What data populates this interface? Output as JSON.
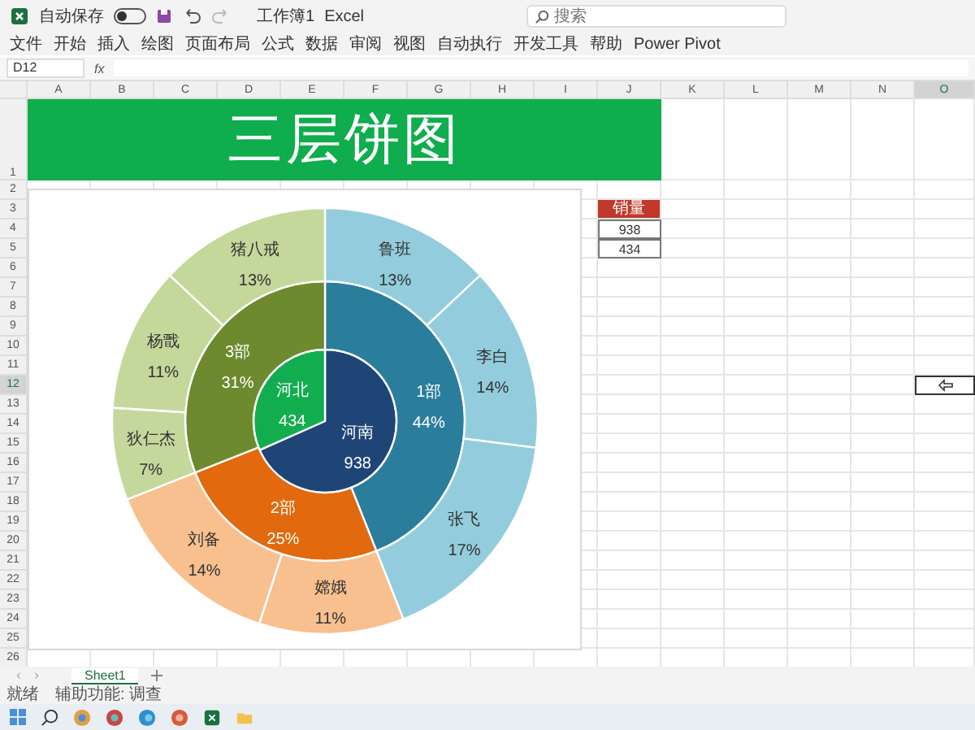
{
  "window": {
    "autosave_label": "自动保存",
    "autosave_on": false,
    "title": "工作簿1",
    "app_name": "Excel",
    "search": {
      "placeholder": "搜索"
    }
  },
  "ribbon_tabs": [
    "文件",
    "开始",
    "插入",
    "绘图",
    "页面布局",
    "公式",
    "数据",
    "审阅",
    "视图",
    "自动执行",
    "开发工具",
    "帮助",
    "Power Pivot"
  ],
  "formula_bar": {
    "name_box": "D12",
    "fx": "fx"
  },
  "sheet": {
    "columns": [
      {
        "label": "A",
        "selected": false
      },
      {
        "label": "B",
        "selected": false
      },
      {
        "label": "C",
        "selected": false
      },
      {
        "label": "D",
        "selected": false
      },
      {
        "label": "E",
        "selected": false
      },
      {
        "label": "F",
        "selected": false
      },
      {
        "label": "G",
        "selected": false
      },
      {
        "label": "H",
        "selected": false
      },
      {
        "label": "I",
        "selected": false
      },
      {
        "label": "J",
        "selected": false
      },
      {
        "label": "K",
        "selected": false
      },
      {
        "label": "L",
        "selected": false
      },
      {
        "label": "M",
        "selected": false
      },
      {
        "label": "N",
        "selected": false
      },
      {
        "label": "O",
        "selected": true
      }
    ],
    "rows": [
      {
        "label": "1",
        "selected": false
      },
      {
        "label": "2",
        "selected": false
      },
      {
        "label": "3",
        "selected": false
      },
      {
        "label": "4",
        "selected": false
      },
      {
        "label": "5",
        "selected": false
      },
      {
        "label": "6",
        "selected": false
      },
      {
        "label": "7",
        "selected": false
      },
      {
        "label": "8",
        "selected": false
      },
      {
        "label": "9",
        "selected": false
      },
      {
        "label": "10",
        "selected": false
      },
      {
        "label": "11",
        "selected": false
      },
      {
        "label": "12",
        "selected": true
      },
      {
        "label": "13",
        "selected": false
      },
      {
        "label": "14",
        "selected": false
      },
      {
        "label": "15",
        "selected": false
      },
      {
        "label": "16",
        "selected": false
      },
      {
        "label": "17",
        "selected": false
      },
      {
        "label": "18",
        "selected": false
      },
      {
        "label": "19",
        "selected": false
      },
      {
        "label": "20",
        "selected": false
      },
      {
        "label": "21",
        "selected": false
      },
      {
        "label": "22",
        "selected": false
      },
      {
        "label": "23",
        "selected": false
      },
      {
        "label": "24",
        "selected": false
      },
      {
        "label": "25",
        "selected": false
      },
      {
        "label": "26",
        "selected": false
      }
    ],
    "banner": {
      "text": "三层饼图"
    },
    "sales_table": {
      "header": "销量",
      "values": [
        "938",
        "434"
      ]
    }
  },
  "chart": {
    "chart_data": {
      "type": "donut",
      "data_labels": true,
      "series": [
        {
          "values": [
            938,
            434
          ],
          "value_labels": [
            "938",
            "434"
          ],
          "colors": [
            "#1f4577",
            "#12ad4f"
          ]
        },
        {
          "values": [
            44,
            25,
            31
          ],
          "value_labels": [
            "44%",
            "25%",
            "31%"
          ],
          "colors": [
            "#2b7d9c",
            "#e2690e",
            "#6e8a2f"
          ]
        },
        {
          "values": [
            13,
            14,
            17,
            11,
            14,
            7,
            11,
            13
          ],
          "value_labels": [
            "13%",
            "14%",
            "17%",
            "11%",
            "14%",
            "7%",
            "11%",
            "13%"
          ],
          "colors": [
            "#93cddd",
            "#93cddd",
            "#93cddd",
            "#f9c08f",
            "#f9c08f",
            "#c5d89c",
            "#c5d89c",
            "#c5d89c"
          ]
        }
      ]
    },
    "segment_names": [
      [
        "河南",
        "河北"
      ],
      [
        "1部",
        "2部",
        "3部"
      ],
      [
        "鲁班",
        "李白",
        "张飞",
        "嫦娥",
        "刘备",
        "狄仁杰",
        "杨戬",
        "猪八戒"
      ]
    ]
  },
  "sheet_nav": [
    "‹",
    "›"
  ],
  "sheet_tabs": [
    {
      "label": "Sheet1",
      "selected": true
    }
  ],
  "status_bar": [
    "就绪",
    "辅助功能: 调查"
  ]
}
